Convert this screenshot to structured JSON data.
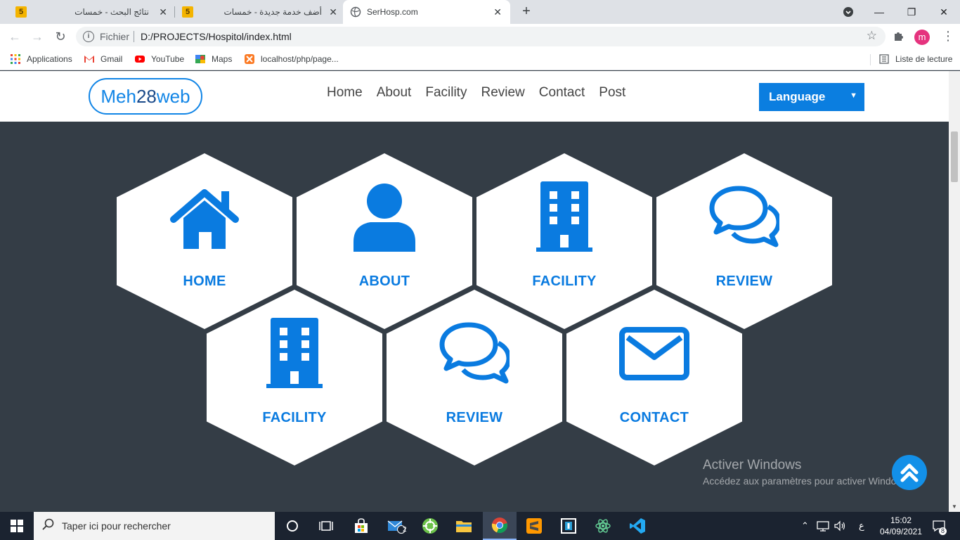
{
  "browser": {
    "tabs": [
      {
        "favicon": "5",
        "title": "نتائج البحث - خمسات",
        "active": false
      },
      {
        "favicon": "5",
        "title": "أضف خدمة جديدة - خمسات",
        "active": false
      },
      {
        "favicon": "globe",
        "title": "SerHosp.com",
        "active": true
      }
    ],
    "address": {
      "scheme": "Fichier",
      "url": "D:/PROJECTS/Hospitol/index.html"
    },
    "profile_initial": "m",
    "bookmarks": [
      {
        "label": "Applications",
        "icon": "apps-grid-icon"
      },
      {
        "label": "Gmail",
        "icon": "gmail-icon"
      },
      {
        "label": "YouTube",
        "icon": "youtube-icon"
      },
      {
        "label": "Maps",
        "icon": "maps-icon"
      },
      {
        "label": "localhost/php/page...",
        "icon": "xampp-icon"
      }
    ],
    "reading_list": "Liste de lecture"
  },
  "site": {
    "logo": {
      "part1": "Meh",
      "part2": "28",
      "part3": "web"
    },
    "nav": [
      "Home",
      "About",
      "Facility",
      "Review",
      "Contact",
      "Post"
    ],
    "language_select": "Language",
    "hexes": [
      {
        "label": "HOME",
        "icon": "home-icon"
      },
      {
        "label": "ABOUT",
        "icon": "user-icon"
      },
      {
        "label": "FACILITY",
        "icon": "building-icon"
      },
      {
        "label": "REVIEW",
        "icon": "comments-icon"
      },
      {
        "label": "FACILITY",
        "icon": "building-icon"
      },
      {
        "label": "REVIEW",
        "icon": "comments-icon"
      },
      {
        "label": "CONTACT",
        "icon": "envelope-icon"
      }
    ],
    "colors": {
      "accent": "#0a7be0",
      "background": "#343d46"
    }
  },
  "watermark": {
    "line1": "Activer Windows",
    "line2": "Accédez aux paramètres pour activer Windows."
  },
  "taskbar": {
    "search_placeholder": "Taper ici pour rechercher",
    "mail_badge": "2",
    "language": "ع",
    "time": "15:02",
    "date": "04/09/2021",
    "notification_count": "8"
  }
}
